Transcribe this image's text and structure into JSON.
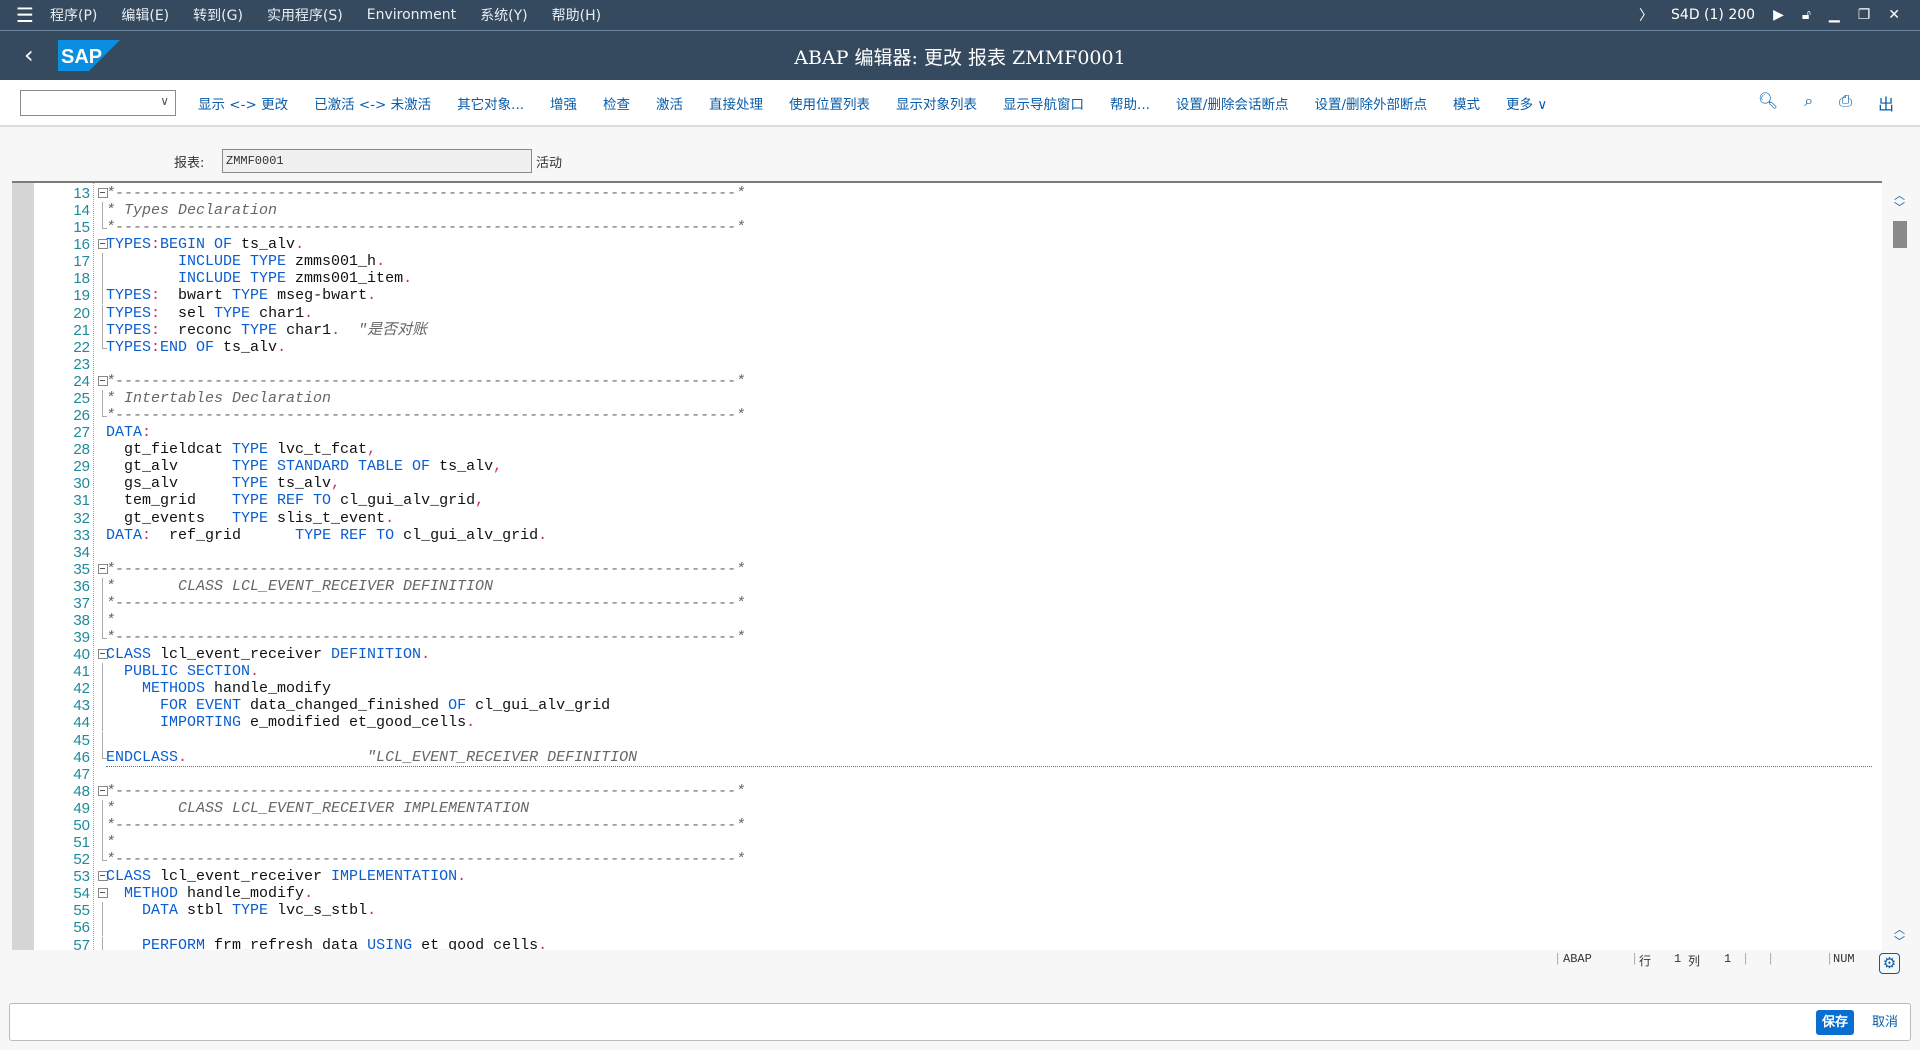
{
  "menubar": {
    "items": [
      "程序(P)",
      "编辑(E)",
      "转到(G)",
      "实用程序(S)",
      "Environment",
      "系统(Y)",
      "帮助(H)"
    ],
    "system": "S4D (1) 200"
  },
  "titlebar": {
    "title": "ABAP 编辑器: 更改 报表 ZMMF0001",
    "logo": "SAP"
  },
  "toolbar": {
    "dropdown_value": "",
    "buttons": [
      "显示 <-> 更改",
      "已激活 <-> 未激活",
      "其它对象...",
      "增强",
      "检查",
      "激活",
      "直接处理",
      "使用位置列表",
      "显示对象列表",
      "显示导航窗口",
      "帮助...",
      "设置/删除会话断点",
      "设置/删除外部断点",
      "模式",
      "更多 ∨"
    ],
    "icons": [
      "search-icon",
      "search-next-icon",
      "print-icon",
      "exit-icon"
    ]
  },
  "report": {
    "label": "报表:",
    "value": "ZMMF0001",
    "status": "活动"
  },
  "colors": {
    "shell": "#354a5f",
    "keyword": "#0a5dd0",
    "linenum": "#1f8a9a",
    "comment": "#666666",
    "save": "#0a6ed1"
  },
  "editor": {
    "lines": [
      {
        "n": "13",
        "fold": "start",
        "seg": [
          [
            "c",
            "*---------------------------------------------------------------------*"
          ]
        ]
      },
      {
        "n": "14",
        "fold": "mid",
        "seg": [
          [
            "c",
            "* Types Declaration"
          ]
        ]
      },
      {
        "n": "15",
        "fold": "end",
        "seg": [
          [
            "c",
            "*---------------------------------------------------------------------*"
          ]
        ]
      },
      {
        "n": "16",
        "fold": "start",
        "seg": [
          [
            "k",
            "TYPES"
          ],
          [
            "p",
            ":"
          ],
          [
            "k",
            "BEGIN OF"
          ],
          [
            "t",
            " ts_alv"
          ],
          [
            "p",
            "."
          ]
        ]
      },
      {
        "n": "17",
        "fold": "mid",
        "seg": [
          [
            "t",
            "        "
          ],
          [
            "k",
            "INCLUDE TYPE"
          ],
          [
            "t",
            " zmms001_h"
          ],
          [
            "p",
            "."
          ]
        ]
      },
      {
        "n": "18",
        "fold": "mid",
        "seg": [
          [
            "t",
            "        "
          ],
          [
            "k",
            "INCLUDE TYPE"
          ],
          [
            "t",
            " zmms001_item"
          ],
          [
            "p",
            "."
          ]
        ]
      },
      {
        "n": "19",
        "fold": "mid",
        "seg": [
          [
            "k",
            "TYPES"
          ],
          [
            "p",
            ":"
          ],
          [
            "t",
            "  bwart "
          ],
          [
            "k",
            "TYPE"
          ],
          [
            "t",
            " mseg-bwart"
          ],
          [
            "p",
            "."
          ]
        ]
      },
      {
        "n": "20",
        "fold": "mid",
        "seg": [
          [
            "k",
            "TYPES"
          ],
          [
            "p",
            ":"
          ],
          [
            "t",
            "  sel "
          ],
          [
            "k",
            "TYPE"
          ],
          [
            "t",
            " char1"
          ],
          [
            "p",
            "."
          ]
        ]
      },
      {
        "n": "21",
        "fold": "mid",
        "seg": [
          [
            "k",
            "TYPES"
          ],
          [
            "p",
            ":"
          ],
          [
            "t",
            "  reconc "
          ],
          [
            "k",
            "TYPE"
          ],
          [
            "t",
            " char1"
          ],
          [
            "p",
            "."
          ],
          [
            "c",
            "  \"是否对账"
          ]
        ]
      },
      {
        "n": "22",
        "fold": "end",
        "seg": [
          [
            "k",
            "TYPES"
          ],
          [
            "p",
            ":"
          ],
          [
            "k",
            "END OF"
          ],
          [
            "t",
            " ts_alv"
          ],
          [
            "p",
            "."
          ]
        ]
      },
      {
        "n": "23",
        "fold": "",
        "seg": []
      },
      {
        "n": "24",
        "fold": "start",
        "seg": [
          [
            "c",
            "*---------------------------------------------------------------------*"
          ]
        ]
      },
      {
        "n": "25",
        "fold": "mid",
        "seg": [
          [
            "c",
            "* Intertables Declaration"
          ]
        ]
      },
      {
        "n": "26",
        "fold": "end",
        "seg": [
          [
            "c",
            "*---------------------------------------------------------------------*"
          ]
        ]
      },
      {
        "n": "27",
        "fold": "",
        "seg": [
          [
            "k",
            "DATA"
          ],
          [
            "p",
            ":"
          ]
        ]
      },
      {
        "n": "28",
        "fold": "",
        "seg": [
          [
            "t",
            "  gt_fieldcat "
          ],
          [
            "k",
            "TYPE"
          ],
          [
            "t",
            " lvc_t_fcat"
          ],
          [
            "p",
            ","
          ]
        ]
      },
      {
        "n": "29",
        "fold": "",
        "seg": [
          [
            "t",
            "  gt_alv      "
          ],
          [
            "k",
            "TYPE STANDARD TABLE OF"
          ],
          [
            "t",
            " ts_alv"
          ],
          [
            "p",
            ","
          ]
        ]
      },
      {
        "n": "30",
        "fold": "",
        "seg": [
          [
            "t",
            "  gs_alv      "
          ],
          [
            "k",
            "TYPE"
          ],
          [
            "t",
            " ts_alv"
          ],
          [
            "p",
            ","
          ]
        ]
      },
      {
        "n": "31",
        "fold": "",
        "seg": [
          [
            "t",
            "  tem_grid    "
          ],
          [
            "k",
            "TYPE REF TO"
          ],
          [
            "t",
            " cl_gui_alv_grid"
          ],
          [
            "p",
            ","
          ]
        ]
      },
      {
        "n": "32",
        "fold": "",
        "seg": [
          [
            "t",
            "  gt_events   "
          ],
          [
            "k",
            "TYPE"
          ],
          [
            "t",
            " slis_t_event"
          ],
          [
            "p",
            "."
          ]
        ]
      },
      {
        "n": "33",
        "fold": "",
        "seg": [
          [
            "k",
            "DATA"
          ],
          [
            "p",
            ":"
          ],
          [
            "t",
            "  ref_grid      "
          ],
          [
            "k",
            "TYPE REF TO"
          ],
          [
            "t",
            " cl_gui_alv_grid"
          ],
          [
            "p",
            "."
          ]
        ]
      },
      {
        "n": "34",
        "fold": "",
        "seg": []
      },
      {
        "n": "35",
        "fold": "start",
        "seg": [
          [
            "c",
            "*---------------------------------------------------------------------*"
          ]
        ]
      },
      {
        "n": "36",
        "fold": "mid",
        "seg": [
          [
            "c",
            "*       CLASS LCL_EVENT_RECEIVER DEFINITION"
          ]
        ]
      },
      {
        "n": "37",
        "fold": "mid",
        "seg": [
          [
            "c",
            "*---------------------------------------------------------------------*"
          ]
        ]
      },
      {
        "n": "38",
        "fold": "mid",
        "seg": [
          [
            "c",
            "*"
          ]
        ]
      },
      {
        "n": "39",
        "fold": "end",
        "seg": [
          [
            "c",
            "*---------------------------------------------------------------------*"
          ]
        ]
      },
      {
        "n": "40",
        "fold": "start",
        "seg": [
          [
            "k",
            "CLASS"
          ],
          [
            "t",
            " lcl_event_receiver "
          ],
          [
            "k",
            "DEFINITION"
          ],
          [
            "p",
            "."
          ]
        ]
      },
      {
        "n": "41",
        "fold": "mid",
        "seg": [
          [
            "t",
            "  "
          ],
          [
            "k",
            "PUBLIC SECTION"
          ],
          [
            "p",
            "."
          ]
        ]
      },
      {
        "n": "42",
        "fold": "mid",
        "seg": [
          [
            "t",
            "    "
          ],
          [
            "k",
            "METHODS"
          ],
          [
            "t",
            " handle_modify"
          ]
        ]
      },
      {
        "n": "43",
        "fold": "mid",
        "seg": [
          [
            "t",
            "      "
          ],
          [
            "k",
            "FOR EVENT"
          ],
          [
            "t",
            " data_changed_finished "
          ],
          [
            "k",
            "OF"
          ],
          [
            "t",
            " cl_gui_alv_grid"
          ]
        ]
      },
      {
        "n": "44",
        "fold": "mid",
        "seg": [
          [
            "t",
            "      "
          ],
          [
            "k",
            "IMPORTING"
          ],
          [
            "t",
            " e_modified et_good_cells"
          ],
          [
            "p",
            "."
          ]
        ]
      },
      {
        "n": "45",
        "fold": "mid",
        "seg": []
      },
      {
        "n": "46",
        "fold": "end",
        "underline": true,
        "seg": [
          [
            "k",
            "ENDCLASS"
          ],
          [
            "p",
            "."
          ],
          [
            "c",
            "                    \"LCL_EVENT_RECEIVER DEFINITION"
          ]
        ]
      },
      {
        "n": "47",
        "fold": "",
        "seg": []
      },
      {
        "n": "48",
        "fold": "start",
        "seg": [
          [
            "c",
            "*---------------------------------------------------------------------*"
          ]
        ]
      },
      {
        "n": "49",
        "fold": "mid",
        "seg": [
          [
            "c",
            "*       CLASS LCL_EVENT_RECEIVER IMPLEMENTATION"
          ]
        ]
      },
      {
        "n": "50",
        "fold": "mid",
        "seg": [
          [
            "c",
            "*---------------------------------------------------------------------*"
          ]
        ]
      },
      {
        "n": "51",
        "fold": "mid",
        "seg": [
          [
            "c",
            "*"
          ]
        ]
      },
      {
        "n": "52",
        "fold": "end",
        "seg": [
          [
            "c",
            "*---------------------------------------------------------------------*"
          ]
        ]
      },
      {
        "n": "53",
        "fold": "start",
        "seg": [
          [
            "k",
            "CLASS"
          ],
          [
            "t",
            " lcl_event_receiver "
          ],
          [
            "k",
            "IMPLEMENTATION"
          ],
          [
            "p",
            "."
          ]
        ]
      },
      {
        "n": "54",
        "fold": "start",
        "seg": [
          [
            "t",
            "  "
          ],
          [
            "k",
            "METHOD"
          ],
          [
            "t",
            " handle_modify"
          ],
          [
            "p",
            "."
          ]
        ]
      },
      {
        "n": "55",
        "fold": "mid",
        "seg": [
          [
            "t",
            "    "
          ],
          [
            "k",
            "DATA"
          ],
          [
            "t",
            " stbl "
          ],
          [
            "k",
            "TYPE"
          ],
          [
            "t",
            " lvc_s_stbl"
          ],
          [
            "p",
            "."
          ]
        ]
      },
      {
        "n": "56",
        "fold": "mid",
        "seg": []
      },
      {
        "n": "57",
        "fold": "mid",
        "seg": [
          [
            "t",
            "    "
          ],
          [
            "k",
            "PERFORM"
          ],
          [
            "t",
            " frm_refresh_data "
          ],
          [
            "k",
            "USING"
          ],
          [
            "t",
            " et_good_cells"
          ],
          [
            "p",
            "."
          ]
        ]
      }
    ]
  },
  "status": {
    "lang": "ABAP",
    "row_label": "行",
    "row": "1",
    "col_label": "列",
    "col": "1",
    "mode": "NUM"
  },
  "cmdbar": {
    "save": "保存",
    "cancel": "取消"
  }
}
